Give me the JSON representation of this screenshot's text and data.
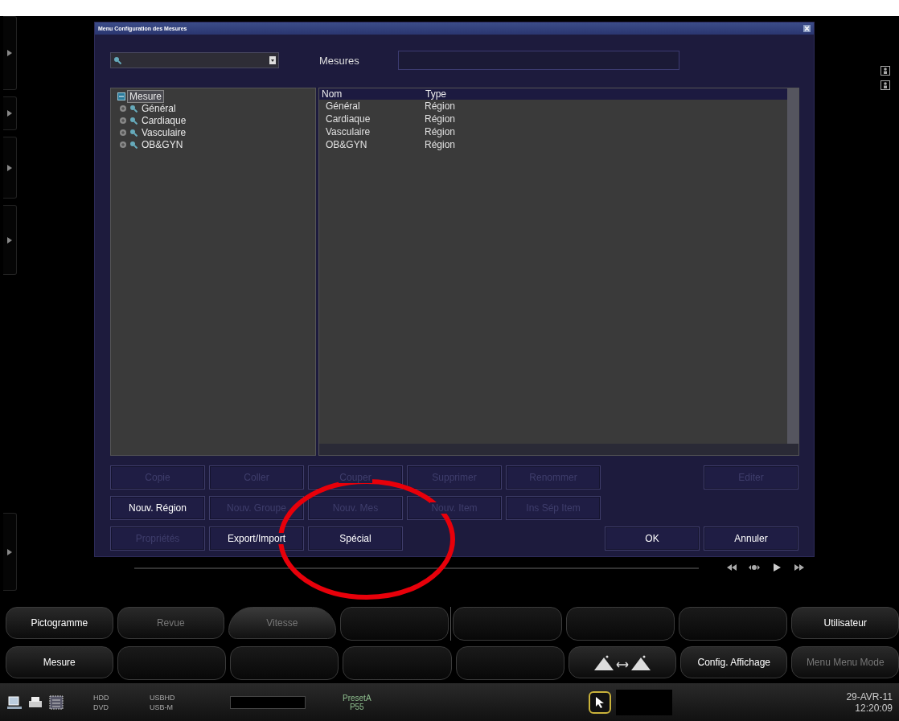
{
  "dialog": {
    "title": "Menu Configuration des Mesures",
    "field_label": "Mesures",
    "tree": {
      "label": "Mesure",
      "expanded": true,
      "selected": true,
      "children": [
        {
          "label": "Général",
          "expanded": false,
          "selected": false
        },
        {
          "label": "Cardiaque",
          "expanded": false,
          "selected": false
        },
        {
          "label": "Vasculaire",
          "expanded": false,
          "selected": false
        },
        {
          "label": "OB&GYN",
          "expanded": false,
          "selected": false
        }
      ]
    },
    "list": {
      "columns": [
        "Nom",
        "Type"
      ],
      "rows": [
        [
          "Général",
          "Région"
        ],
        [
          "Cardiaque",
          "Région"
        ],
        [
          "Vasculaire",
          "Région"
        ],
        [
          "OB&GYN",
          "Région"
        ]
      ]
    },
    "button_rows": [
      [
        {
          "kind": "button",
          "label": "Copie",
          "disabled": true
        },
        {
          "kind": "button",
          "label": "Coller",
          "disabled": true
        },
        {
          "kind": "button",
          "label": "Couper",
          "disabled": true
        },
        {
          "kind": "button",
          "label": "Supprimer",
          "disabled": true
        },
        {
          "kind": "button",
          "label": "Renommer",
          "disabled": true
        },
        {
          "kind": "spacer"
        },
        {
          "kind": "button",
          "label": "Editer",
          "disabled": true
        }
      ],
      [
        {
          "kind": "button",
          "label": "Nouv. Région",
          "disabled": false
        },
        {
          "kind": "button",
          "label": "Nouv. Groupe",
          "disabled": true
        },
        {
          "kind": "button",
          "label": "Nouv. Mes",
          "disabled": true
        },
        {
          "kind": "button",
          "label": "Nouv. Item",
          "disabled": true
        },
        {
          "kind": "button",
          "label": "Ins Sép Item",
          "disabled": true
        }
      ],
      [
        {
          "kind": "button",
          "label": "Propriétés",
          "disabled": true
        },
        {
          "kind": "button",
          "label": "Export/Import",
          "disabled": false
        },
        {
          "kind": "button",
          "label": "Spécial",
          "disabled": false
        },
        {
          "kind": "spacer"
        },
        {
          "kind": "spacer"
        },
        {
          "kind": "button",
          "label": "OK",
          "disabled": false
        },
        {
          "kind": "button",
          "label": "Annuler",
          "disabled": false
        }
      ]
    ]
  },
  "soft_keys": [
    [
      {
        "kind": "key",
        "label": "Pictogramme",
        "disabled": false
      },
      {
        "kind": "key",
        "label": "Revue",
        "disabled": true
      },
      {
        "kind": "knob",
        "label": "Vitesse",
        "disabled": true
      },
      {
        "kind": "empty"
      },
      {
        "kind": "empty"
      },
      {
        "kind": "empty"
      },
      {
        "kind": "empty"
      },
      {
        "kind": "key",
        "label": "Utilisateur",
        "disabled": false
      }
    ],
    [
      {
        "kind": "key",
        "label": "Mesure",
        "disabled": false
      },
      {
        "kind": "empty"
      },
      {
        "kind": "empty"
      },
      {
        "kind": "empty"
      },
      {
        "kind": "empty"
      },
      {
        "kind": "probes"
      },
      {
        "kind": "key",
        "label": "Config. Affichage",
        "disabled": false
      },
      {
        "kind": "key",
        "label": "Menu Menu Mode",
        "disabled": true
      }
    ]
  ],
  "status_bar": {
    "drives": [
      "HDD",
      "USBHD",
      "DVD",
      "USB-M"
    ],
    "preset": "PresetA",
    "preset_sub": "P55",
    "date": "29-AVR-11",
    "time": "12:20:09"
  }
}
